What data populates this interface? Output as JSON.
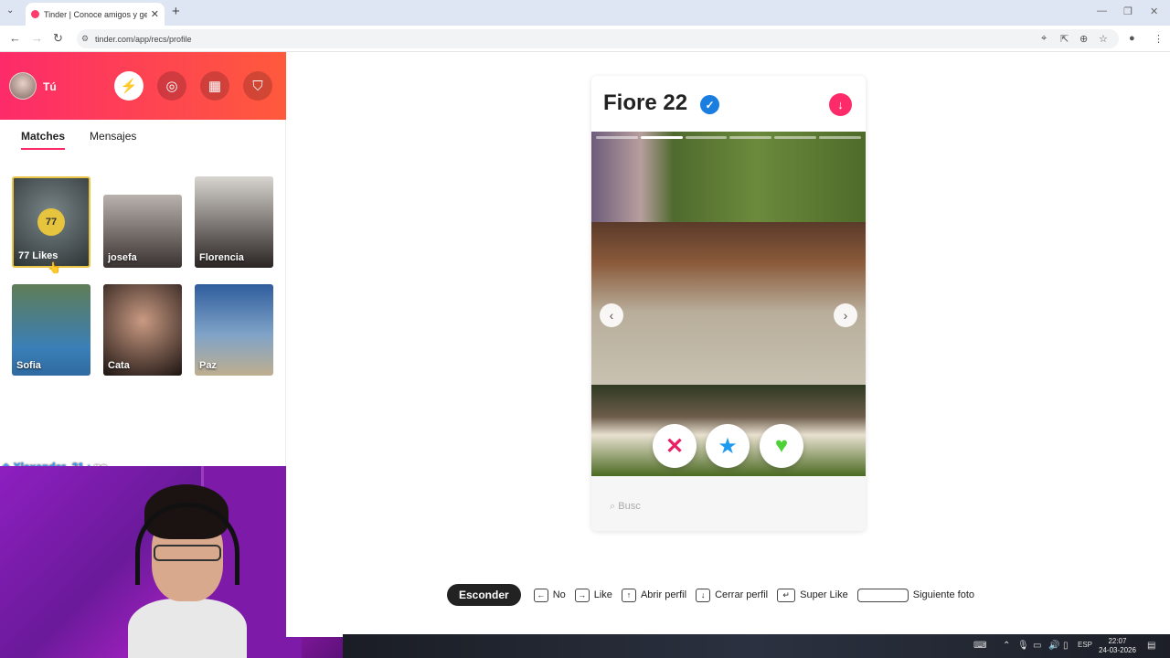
{
  "browser": {
    "tab_title": "Tinder | Conoce amigos y gente",
    "url": "tinder.com/app/recs/profile"
  },
  "sidebar": {
    "user_name": "Tú",
    "tabs": [
      {
        "label": "Matches",
        "active": true
      },
      {
        "label": "Mensajes",
        "active": false
      }
    ],
    "likes": {
      "count": "77",
      "label": "77 Likes"
    },
    "matches": [
      {
        "name": "josefa"
      },
      {
        "name": "Florencia"
      },
      {
        "name": "Sofia"
      },
      {
        "name": "Cata"
      },
      {
        "name": "Paz"
      }
    ]
  },
  "chat": {
    "user": "Xlexander_21",
    "separator": " : ",
    "message": "no"
  },
  "profile": {
    "name_age": "Fiore 22",
    "verified": true,
    "photo_count": 6,
    "current_photo": 1,
    "search_placeholder": "Busc"
  },
  "shortcuts": {
    "hide": "Esconder",
    "no": "No",
    "like": "Like",
    "open_profile": "Abrir perfil",
    "close_profile": "Cerrar perfil",
    "super_like": "Super Like",
    "next_photo": "Siguiente foto"
  },
  "taskbar": {
    "lang": "ESP",
    "time": "22:07",
    "date": "24-03-2026"
  },
  "colors": {
    "brand_gradient_start": "#fd2b6a",
    "brand_gradient_end": "#ff5a3c",
    "likes_gold": "#e7c43d",
    "verified_blue": "#1a7de0"
  }
}
